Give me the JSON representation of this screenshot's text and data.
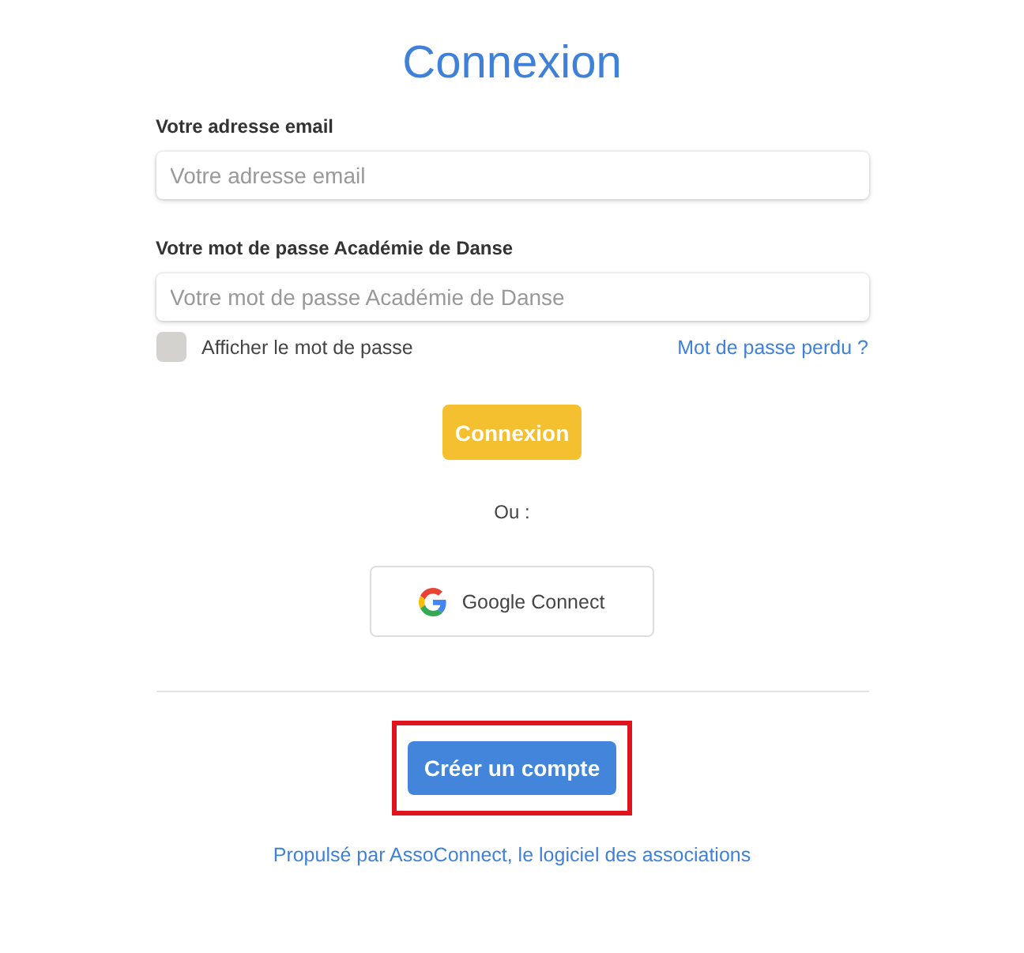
{
  "title": "Connexion",
  "fields": [
    {
      "label": "Votre adresse email",
      "placeholder": "Votre adresse email"
    },
    {
      "label": "Votre mot de passe Académie de Danse",
      "placeholder": "Votre mot de passe Académie de Danse"
    }
  ],
  "show_password": {
    "label": "Afficher le mot de passe",
    "checked": false
  },
  "lost_password_link": "Mot de passe perdu ?",
  "submit_button": "Connexion",
  "separator": "Ou :",
  "google_button": "Google Connect",
  "create_account_button": {
    "label": "Créer un compte",
    "highlighted": true
  },
  "footer_link": "Propulsé par AssoConnect, le logiciel des associations"
}
